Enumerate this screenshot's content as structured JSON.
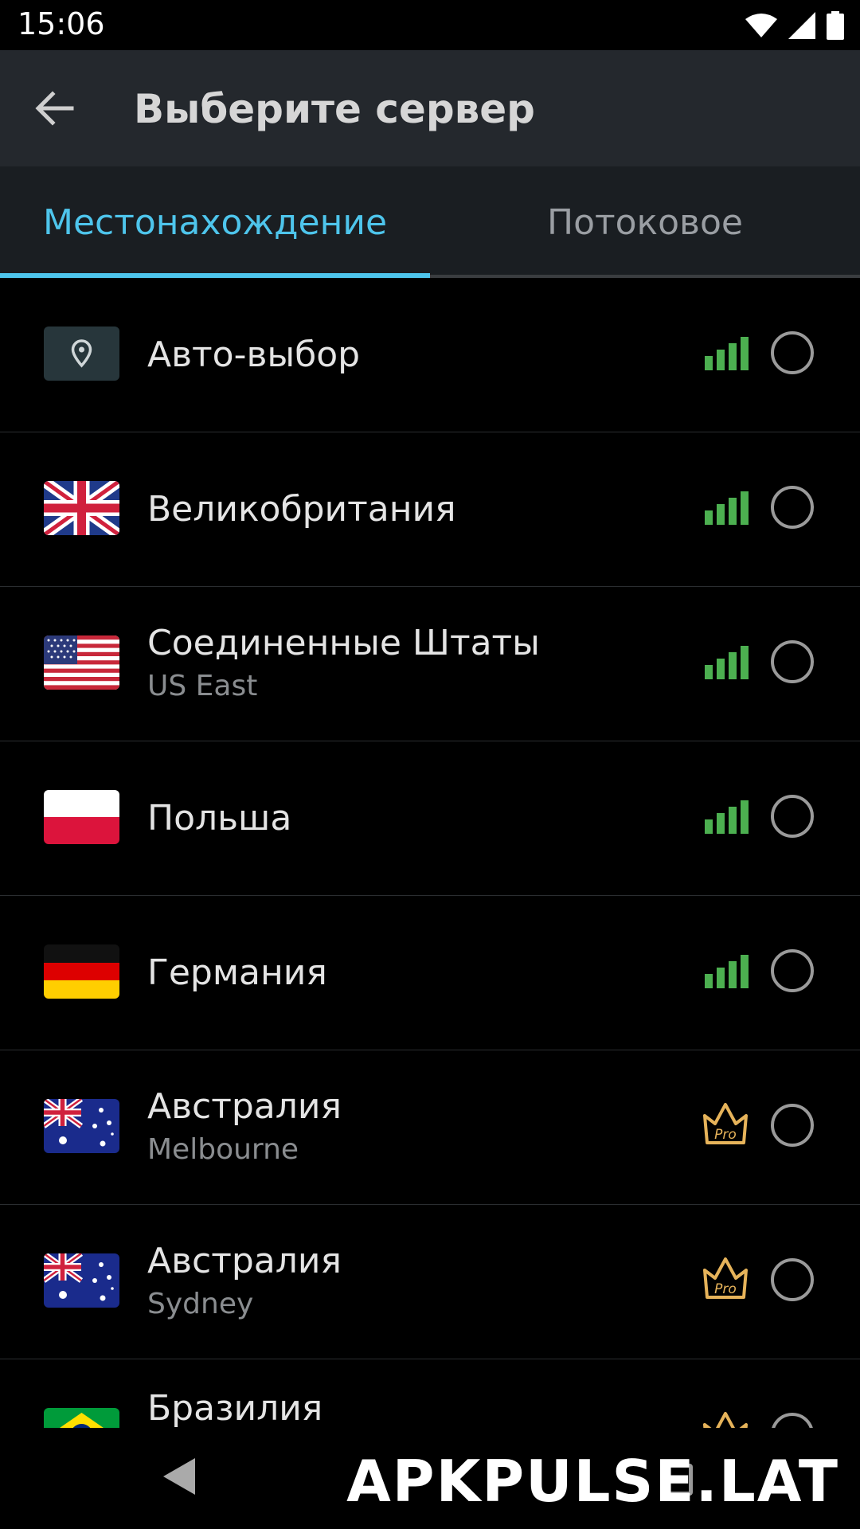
{
  "status_bar": {
    "time": "15:06",
    "icons": [
      "wifi-icon",
      "cell-signal-icon",
      "battery-icon"
    ]
  },
  "app_bar": {
    "title": "Выберите сервер",
    "back_icon": "arrow-left-icon"
  },
  "tabs": [
    {
      "label": "Местонахождение",
      "active": true
    },
    {
      "label": "Потоковое",
      "active": false
    }
  ],
  "colors": {
    "accent": "#4ec5ec",
    "signal": "#4caf50",
    "pro": "#e6b35a",
    "appbar": "#24282d"
  },
  "servers": [
    {
      "country": "Авто-выбор",
      "city": "",
      "flag": "location-pin-icon",
      "badge": "signal"
    },
    {
      "country": "Великобритания",
      "city": "",
      "flag": "uk-flag-icon",
      "badge": "signal"
    },
    {
      "country": "Соединенные Штаты",
      "city": "US East",
      "flag": "us-flag-icon",
      "badge": "signal"
    },
    {
      "country": "Польша",
      "city": "",
      "flag": "poland-flag-icon",
      "badge": "signal"
    },
    {
      "country": "Германия",
      "city": "",
      "flag": "germany-flag-icon",
      "badge": "signal"
    },
    {
      "country": "Австралия",
      "city": "Melbourne",
      "flag": "australia-flag-icon",
      "badge": "pro"
    },
    {
      "country": "Австралия",
      "city": "Sydney",
      "flag": "australia-flag-icon",
      "badge": "pro"
    },
    {
      "country": "Бразилия",
      "city": "",
      "flag": "brazil-flag-icon",
      "badge": "pro"
    }
  ],
  "pro_label": "Pro",
  "watermark": "APKPULSE.LAT"
}
